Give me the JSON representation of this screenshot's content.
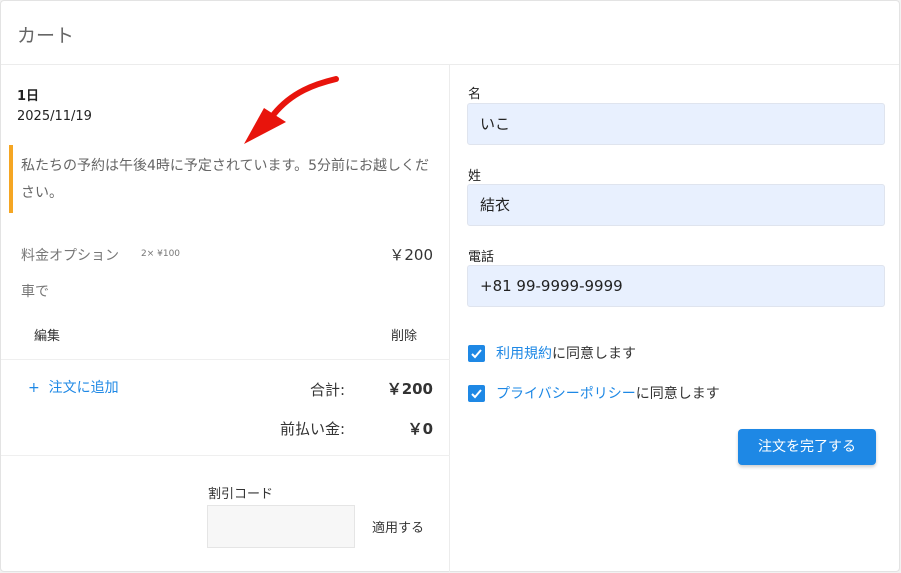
{
  "header": {
    "title": "カート"
  },
  "booking": {
    "day_label": "1日",
    "date": "2025/11/19",
    "notice": "私たちの予約は午後4時に予定されています。5分前にお越しください。"
  },
  "pricing": {
    "option_label": "料金オプション",
    "option_qty": "2× ¥100",
    "option_price": "￥200",
    "transport": "車で",
    "edit_label": "編集",
    "delete_label": "削除"
  },
  "summary": {
    "add_label": "注文に追加",
    "total_label": "合計:",
    "total_value": "￥200",
    "prepay_label": "前払い金:",
    "prepay_value": "￥0"
  },
  "discount": {
    "label": "割引コード",
    "apply_label": "適用する",
    "value": ""
  },
  "form": {
    "first_name_label": "名",
    "first_name_value": "いこ",
    "last_name_label": "姓",
    "last_name_value": "結衣",
    "phone_label": "電話",
    "phone_value": "+81 99-9999-9999",
    "terms_link": "利用規約",
    "terms_suffix": "に同意します",
    "privacy_link": "プライバシーポリシー",
    "privacy_suffix": "に同意します",
    "submit_label": "注文を完了する"
  },
  "colors": {
    "accent": "#1e88e5",
    "notice_border": "#f5a623",
    "arrow": "#e8140c",
    "input_bg": "#e8f0fe"
  }
}
